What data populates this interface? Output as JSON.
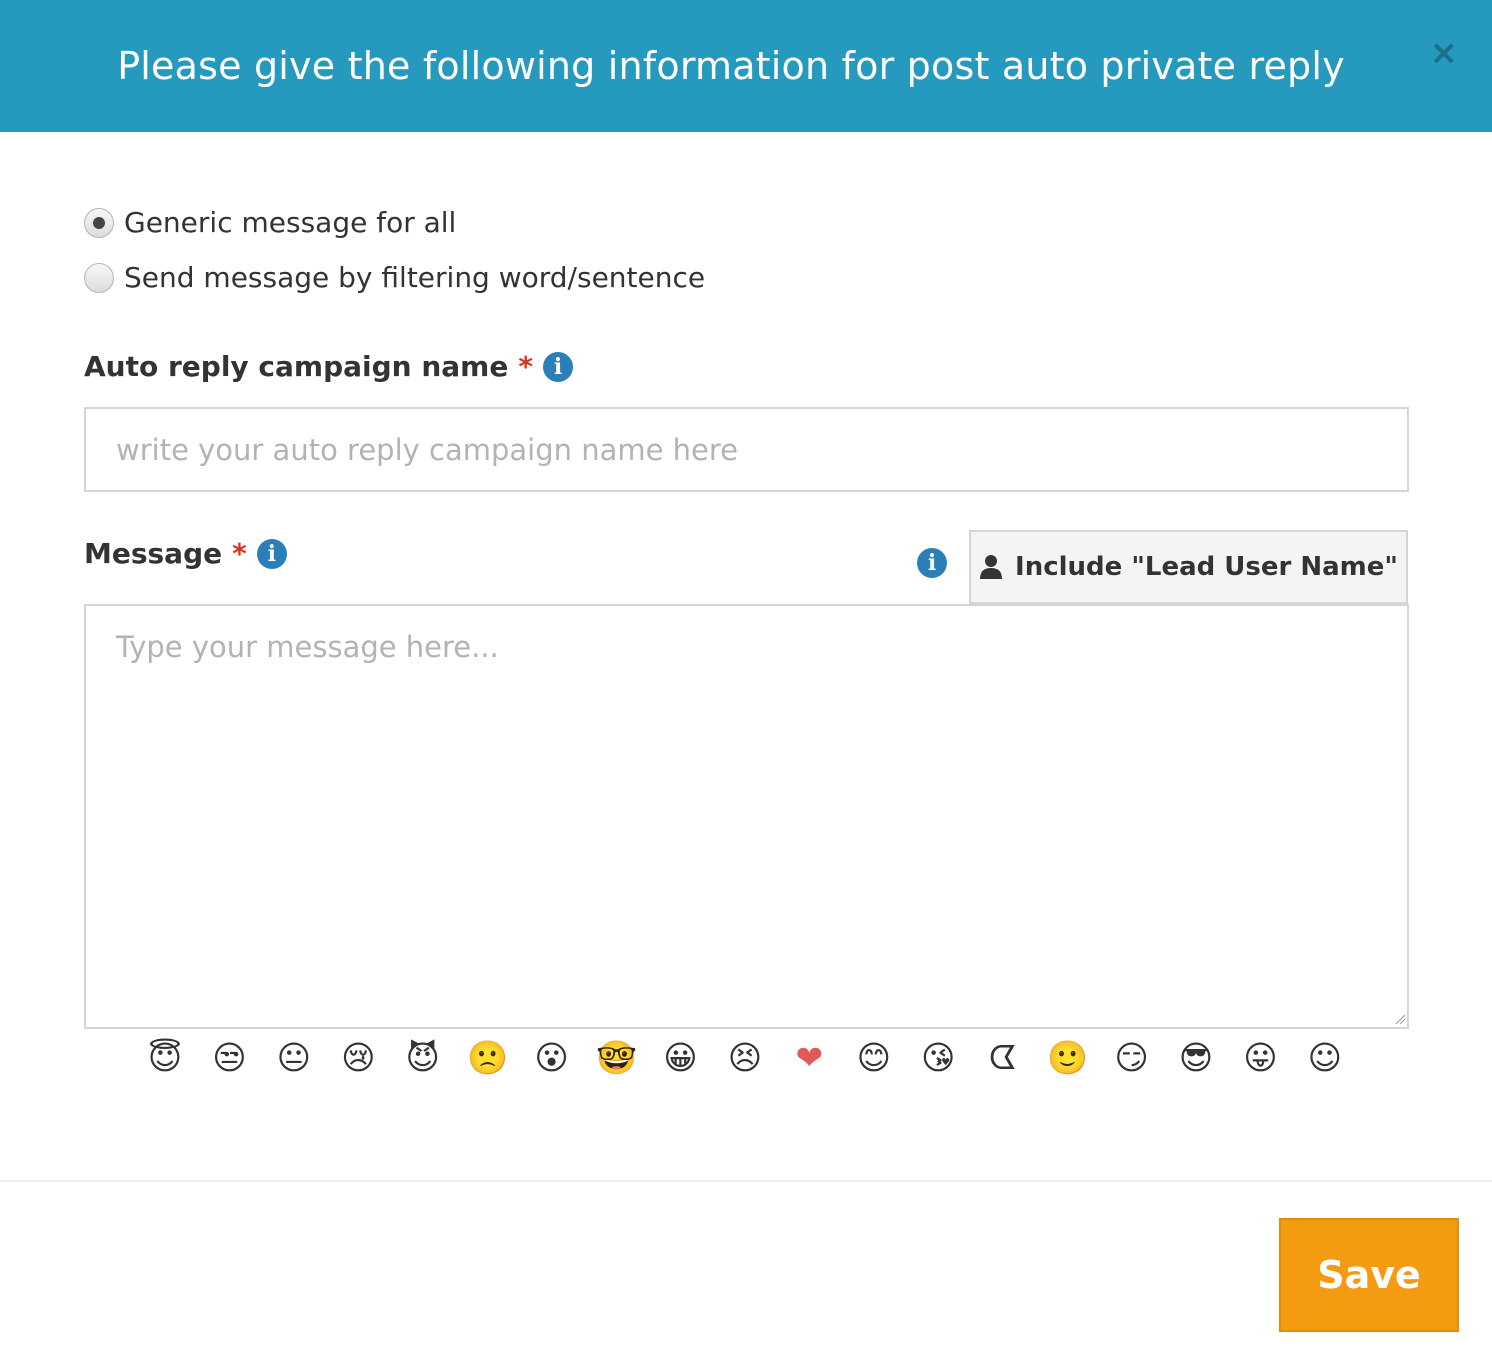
{
  "modal": {
    "title": "Please give the following information for post auto private reply",
    "close_glyph": "×"
  },
  "reply_type": {
    "options": [
      {
        "label": "Generic message for all",
        "checked": true
      },
      {
        "label": "Send message by filtering word/sentence",
        "checked": false
      }
    ]
  },
  "campaign_name": {
    "label": "Auto reply campaign name",
    "required_mark": "*",
    "info_glyph": "i",
    "placeholder": "write your auto reply campaign name here",
    "value": ""
  },
  "message": {
    "label": "Message",
    "required_mark": "*",
    "info_glyph": "i",
    "placeholder": "Type your message here...",
    "value": "",
    "include_button_label": "Include \"Lead User Name\"",
    "include_info_glyph": "i"
  },
  "emojis": [
    {
      "name": "angel-emoji",
      "glyph": "😇"
    },
    {
      "name": "pouting-emoji",
      "glyph": "😒"
    },
    {
      "name": "neutral-emoji",
      "glyph": "😐"
    },
    {
      "name": "crying-emoji",
      "glyph": "😢"
    },
    {
      "name": "devil-emoji",
      "glyph": "😈"
    },
    {
      "name": "frown-emoji",
      "glyph": "🙁"
    },
    {
      "name": "gasp-emoji",
      "glyph": "😮"
    },
    {
      "name": "glasses-emoji",
      "glyph": "🤓"
    },
    {
      "name": "grin-emoji",
      "glyph": "😀"
    },
    {
      "name": "grumpy-emoji",
      "glyph": "😣"
    },
    {
      "name": "heart-emoji",
      "glyph": "❤"
    },
    {
      "name": "kiki-emoji",
      "glyph": "😊"
    },
    {
      "name": "kiss-emoji",
      "glyph": "😘"
    },
    {
      "name": "pacman-emoji",
      "glyph": "ᗧ"
    },
    {
      "name": "smile-emoji",
      "glyph": "🙂"
    },
    {
      "name": "squint-emoji",
      "glyph": "😏"
    },
    {
      "name": "sunglasses-emoji",
      "glyph": "😎"
    },
    {
      "name": "tongue-emoji",
      "glyph": "😛"
    },
    {
      "name": "upset-emoji",
      "glyph": "☺"
    }
  ],
  "footer": {
    "save_label": "Save"
  },
  "colors": {
    "header_bg": "#2699be",
    "save_bg": "#f39c12",
    "info_icon": "#2a7fb8",
    "required": "#d9341f"
  }
}
